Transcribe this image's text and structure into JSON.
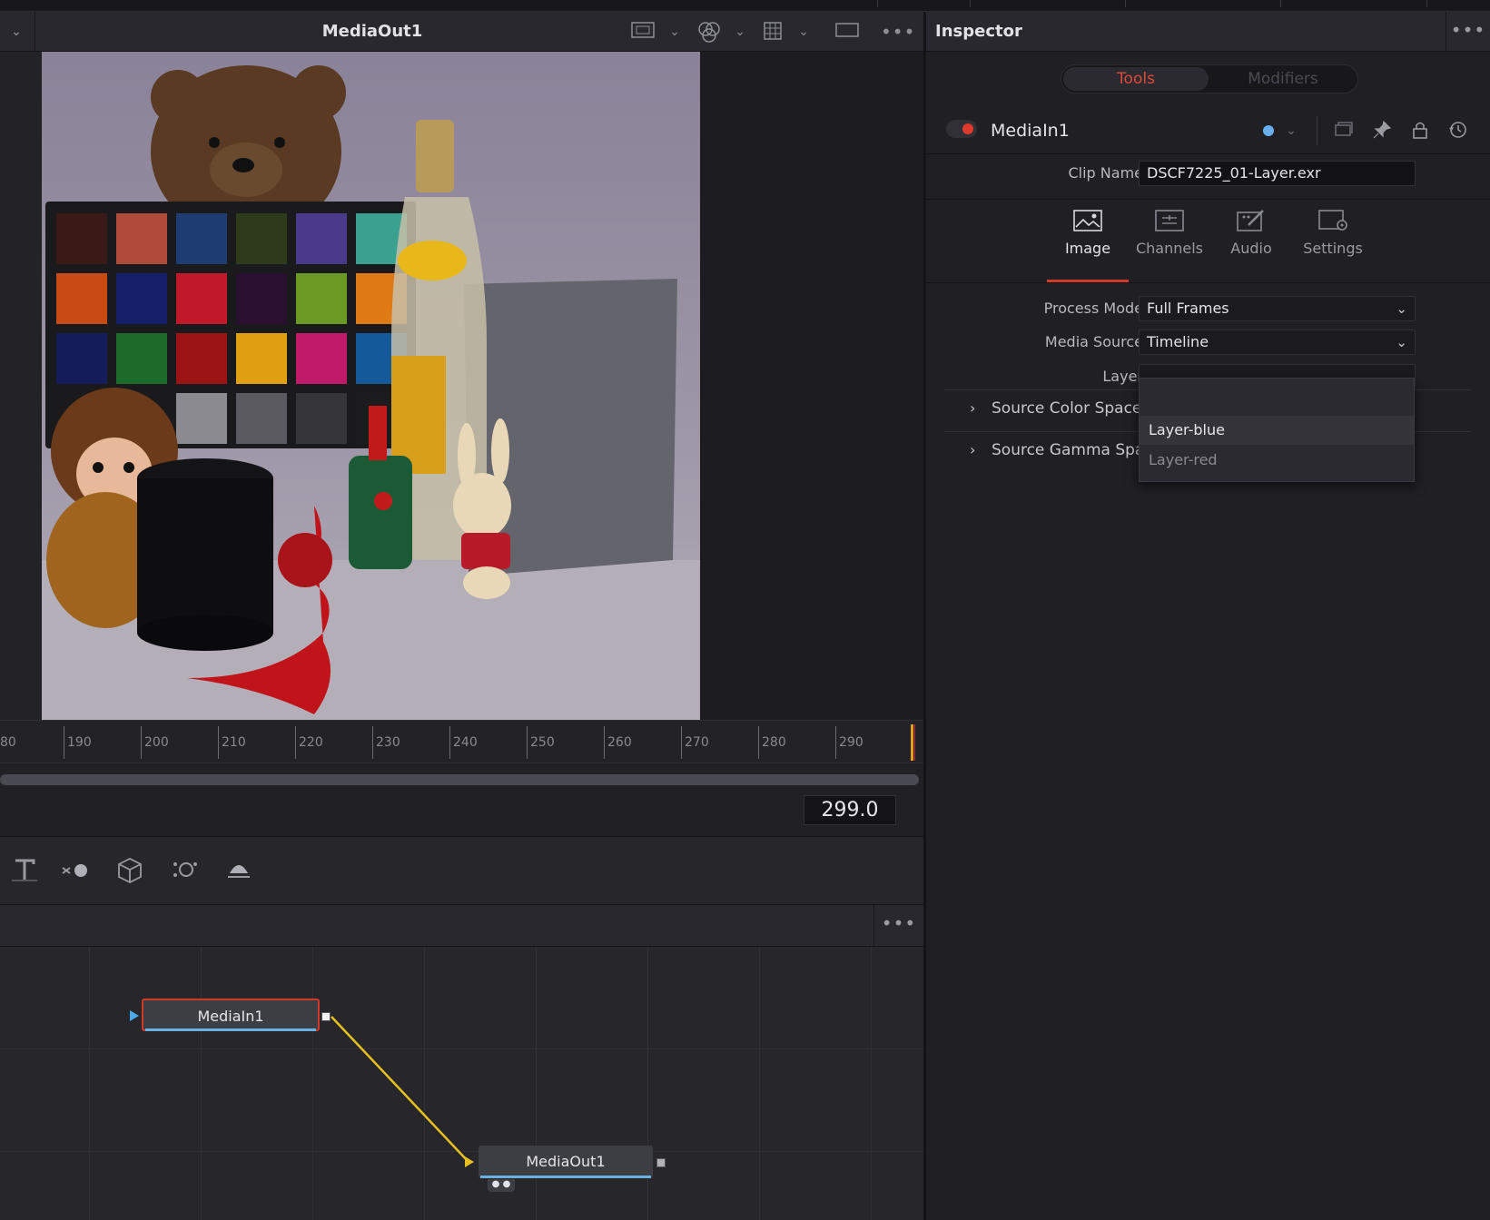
{
  "viewer": {
    "title": "MediaOut1",
    "ruler_labels": [
      "80",
      "190",
      "200",
      "210",
      "220",
      "230",
      "240",
      "250",
      "260",
      "270",
      "280",
      "290"
    ],
    "timecode": "299.0"
  },
  "node_editor": {
    "nodes": [
      {
        "label": "MediaIn1",
        "selected": true
      },
      {
        "label": "MediaOut1",
        "selected": false
      }
    ],
    "link_color": "#e8c020"
  },
  "inspector": {
    "title": "Inspector",
    "segments": {
      "active": "Tools",
      "inactive": "Modifiers"
    },
    "tool_name": "MediaIn1",
    "clip_name_label": "Clip Name",
    "clip_name_value": "DSCF7225_01-Layer.exr",
    "tabs": [
      {
        "label": "Image",
        "icon": "image-icon",
        "active": true
      },
      {
        "label": "Channels",
        "icon": "channels-icon",
        "active": false
      },
      {
        "label": "Audio",
        "icon": "audio-icon",
        "active": false
      },
      {
        "label": "Settings",
        "icon": "settings-icon",
        "active": false
      }
    ],
    "process_mode_label": "Process Mode",
    "process_mode_value": "Full Frames",
    "media_source_label": "Media Source",
    "media_source_value": "Timeline",
    "layer_label": "Layer",
    "layer_value": "",
    "layer_options": [
      "Layer-blue",
      "Layer-red"
    ],
    "sections": [
      {
        "title": "Source Color Space",
        "expanded": false
      },
      {
        "title": "Source Gamma Space",
        "expanded": false
      }
    ]
  },
  "colors": {
    "accent_red": "#d03a2a",
    "accent_blue": "#6ab0ee",
    "playhead": "#e0a020"
  }
}
